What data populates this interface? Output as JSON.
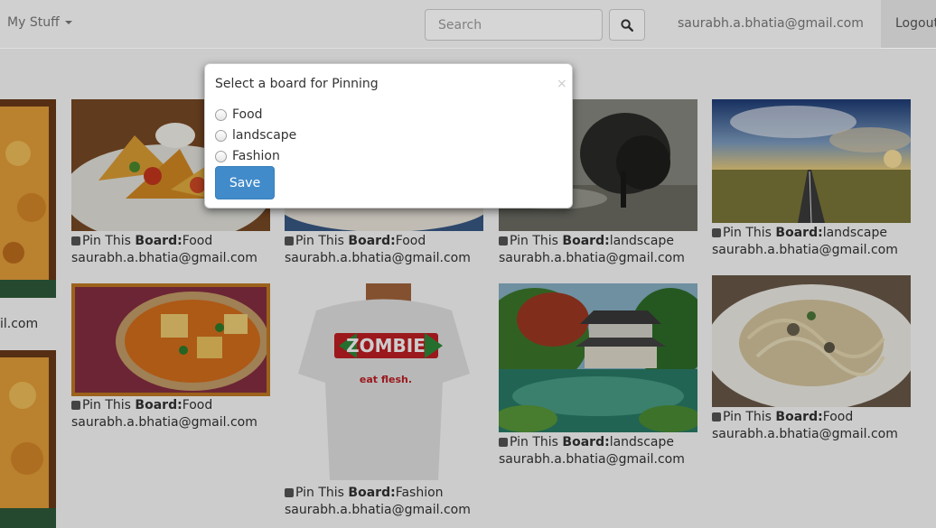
{
  "navbar": {
    "menu_label": "My Stuff",
    "search_placeholder": "Search",
    "user_email": "saurabh.a.bhatia@gmail.com",
    "logout_label": "Logout"
  },
  "pins": [
    {
      "pin_label": "Pin This",
      "board_label": "Board:",
      "board": "Food",
      "email": "saurabh.a.bhatia@gmail.com"
    },
    {
      "pin_label": "Pin This",
      "board_label": "Board:",
      "board": "Food",
      "email": "saurabh.a.bhatia@gmail.com"
    },
    {
      "pin_label": "Pin This",
      "board_label": "Board:",
      "board": "landscape",
      "email": "saurabh.a.bhatia@gmail.com"
    },
    {
      "pin_label": "Pin This",
      "board_label": "Board:",
      "board": "landscape",
      "email": "saurabh.a.bhatia@gmail.com"
    },
    {
      "pin_label": "Pin This",
      "board_label": "Board:",
      "board": "Food",
      "email": "saurabh.a.bhatia@gmail.com"
    },
    {
      "pin_label": "Pin This",
      "board_label": "Board:",
      "board": "Fashion",
      "email": "saurabh.a.bhatia@gmail.com"
    },
    {
      "pin_label": "Pin This",
      "board_label": "Board:",
      "board": "landscape",
      "email": "saurabh.a.bhatia@gmail.com"
    },
    {
      "pin_label": "Pin This",
      "board_label": "Board:",
      "board": "Food",
      "email": "saurabh.a.bhatia@gmail.com"
    }
  ],
  "partial_email": "il.com",
  "tshirt": {
    "word": "ZOMBIE",
    "slogan": "eat flesh."
  },
  "modal": {
    "title": "Select a board for Pinning",
    "close": "×",
    "options": [
      "Food",
      "landscape",
      "Fashion"
    ],
    "save_label": "Save"
  },
  "colors": {
    "primary": "#428bca",
    "overlay": "rgba(0,0,0,0.2)"
  }
}
